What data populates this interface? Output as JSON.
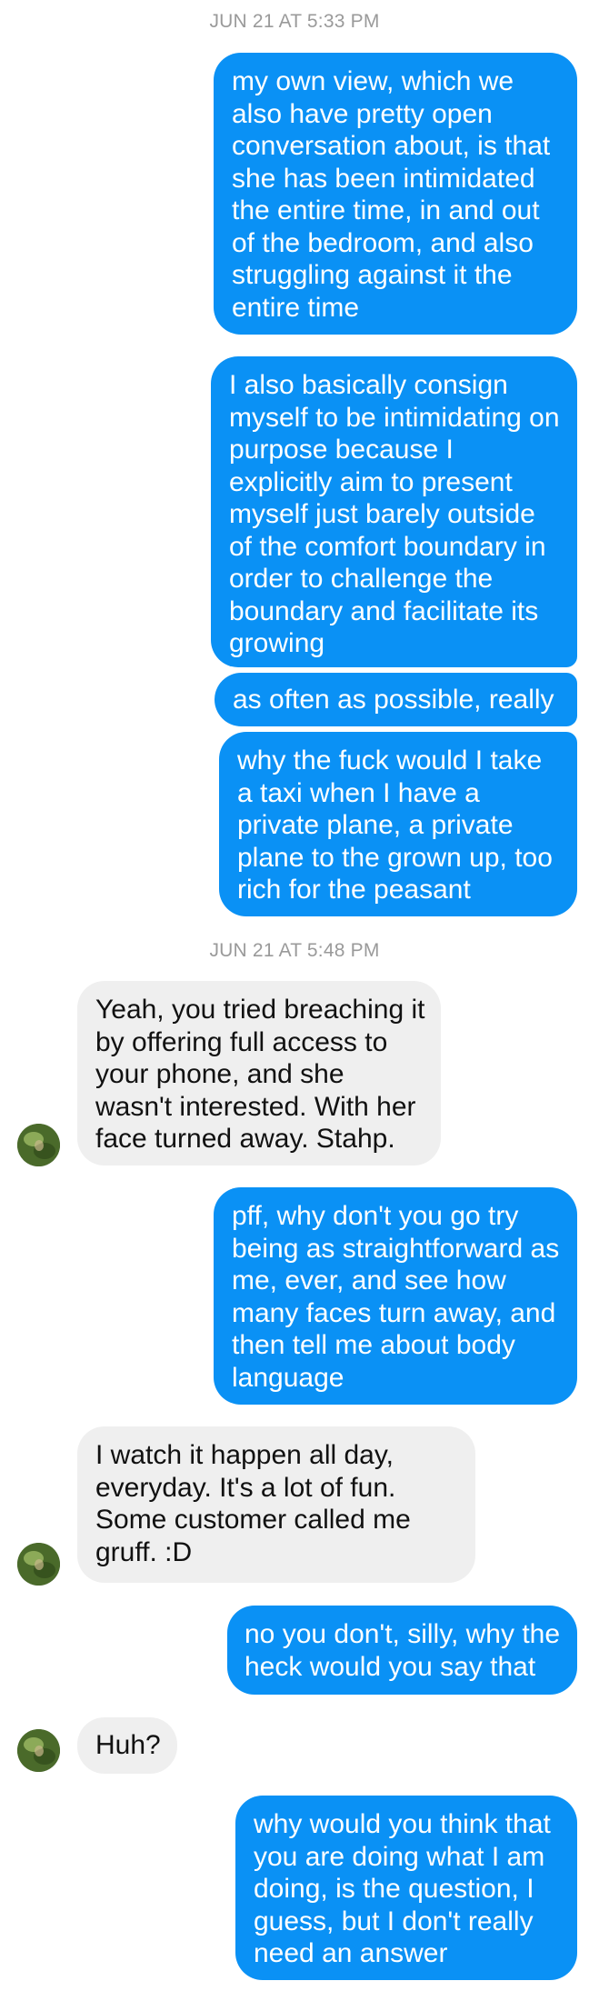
{
  "timestamps": {
    "first": "JUN 21 AT 5:33 PM",
    "second": "JUN 21 AT 5:48 PM"
  },
  "messages": [
    {
      "direction": "out",
      "text": "my own view, which we also have pretty open conversation about, is that she has been intimidated the entire time, in and out of the bedroom, and also struggling against it the entire time"
    },
    {
      "direction": "out",
      "text": "I also basically consign myself to be intimidating on purpose because I explicitly aim to present myself just barely outside of the comfort boundary in order to challenge the boundary and facilitate its growing"
    },
    {
      "direction": "out",
      "text": "as often as possible, really"
    },
    {
      "direction": "out",
      "text": "why the fuck would I take a taxi when I have a private plane, a private plane to the grown up, too rich for the peasant"
    },
    {
      "direction": "in",
      "text": "Yeah, you tried breaching it by offering full access to your phone, and she wasn't interested. With her face turned away. Stahp."
    },
    {
      "direction": "out",
      "text": "pff, why don't you go try being as straightforward as me, ever, and see how many faces turn away, and then tell me about body language"
    },
    {
      "direction": "in",
      "text": "I watch it happen all day, everyday. It's a lot of fun. Some customer called me gruff. :D"
    },
    {
      "direction": "out",
      "text": "no you don't, silly, why the heck would you say that"
    },
    {
      "direction": "in",
      "text": "Huh?"
    },
    {
      "direction": "out",
      "text": "why would you think that you are doing what I am doing, is the question, I guess, but I don't really need an answer"
    }
  ],
  "colors": {
    "outgoing_bubble": "#0a91f5",
    "incoming_bubble": "#efefef",
    "timestamp_text": "#9a9a9a"
  },
  "icons": {
    "avatar": "contact-avatar-photo"
  }
}
